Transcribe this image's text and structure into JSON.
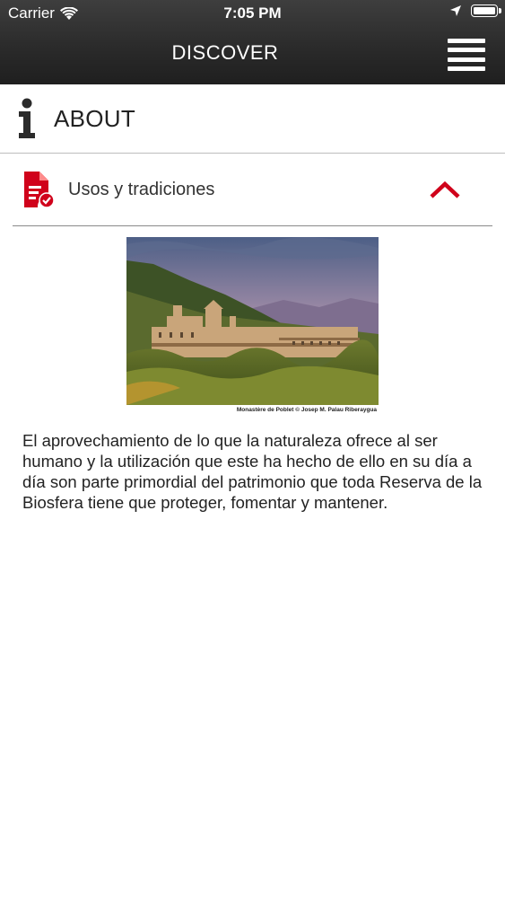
{
  "status_bar": {
    "carrier": "Carrier",
    "time": "7:05 PM"
  },
  "nav": {
    "title": "DISCOVER",
    "menu_icon": "hamburger-menu-icon"
  },
  "about": {
    "label": "ABOUT",
    "icon": "info-icon"
  },
  "section": {
    "label": "Usos y tradiciones",
    "icon": "document-check-icon",
    "expanded": true,
    "accent_color": "#d0021b"
  },
  "photo": {
    "caption": "Monastère de Poblet © Josep M. Palau Riberaygua"
  },
  "content": {
    "paragraph": "El aprovechamiento de lo que la naturaleza ofrece al ser humano y la utilización que este ha hecho de ello en su día a día son parte primordial del patrimonio que toda Reserva de la Biosfera tiene que proteger, fomentar y mantener."
  }
}
